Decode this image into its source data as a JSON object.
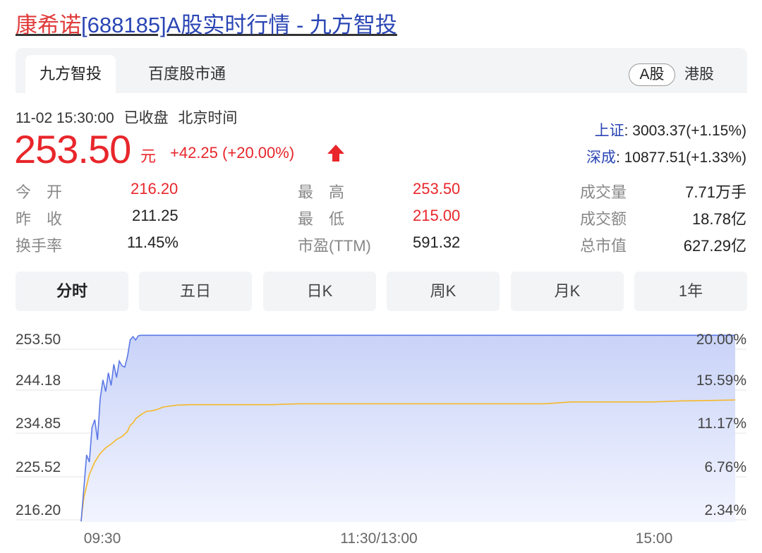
{
  "header": {
    "stock_name": "康希诺",
    "title_rest": "[688185]A股实时行情 - 九方智投"
  },
  "tabs": [
    {
      "label": "九方智投",
      "active": true
    },
    {
      "label": "百度股市通",
      "active": false
    }
  ],
  "market_toggle": {
    "a_share": "A股",
    "hk_share": "港股"
  },
  "quote": {
    "timestamp": "11-02 15:30:00",
    "status": "已收盘",
    "timezone": "北京时间",
    "price": "253.50",
    "unit": "元",
    "change": "+42.25",
    "change_pct": "(+20.00%)",
    "direction_icon": "up-arrow-icon",
    "up_color": "#e8262b"
  },
  "indices": [
    {
      "name": "上证",
      "value": ": 3003.37(+1.15%)"
    },
    {
      "name": "深成",
      "value": ": 10877.51(+1.33%)"
    }
  ],
  "stats": {
    "open_label": "今　开",
    "open": "216.20",
    "prev_close_label": "昨　收",
    "prev_close": "211.25",
    "turnover_rate_label": "换手率",
    "turnover_rate": "11.45%",
    "high_label": "最　高",
    "high": "253.50",
    "low_label": "最　低",
    "low": "215.00",
    "pe_label": "市盈(TTM)",
    "pe": "591.32",
    "volume_label": "成交量",
    "volume": "7.71万手",
    "amount_label": "成交额",
    "amount": "18.78亿",
    "market_cap_label": "总市值",
    "market_cap": "627.29亿"
  },
  "periods": [
    {
      "label": "分时",
      "active": true
    },
    {
      "label": "五日",
      "active": false
    },
    {
      "label": "日K",
      "active": false
    },
    {
      "label": "周K",
      "active": false
    },
    {
      "label": "月K",
      "active": false
    },
    {
      "label": "1年",
      "active": false
    }
  ],
  "chart_data": {
    "type": "area",
    "y_labels": [
      "253.50",
      "244.18",
      "234.85",
      "225.52",
      "216.20"
    ],
    "y_right_labels": [
      "20.00%",
      "15.59%",
      "11.17%",
      "6.76%",
      "2.34%"
    ],
    "x_labels": [
      "09:30",
      "11:30/13:00",
      "15:00"
    ],
    "ylim": [
      213.7,
      254.6
    ],
    "minutes_total": 240,
    "colors": {
      "price_line": "#5b78e6",
      "avg_line": "#f5b82a",
      "area_top": "#c9d3f8",
      "area_bottom": "#f2f4fe",
      "grid": "#e6e6e6"
    },
    "series": [
      {
        "name": "price",
        "x": [
          0,
          2,
          3,
          4,
          5,
          6,
          7,
          8,
          9,
          10,
          11,
          12,
          13,
          14,
          15,
          16,
          17,
          18,
          19,
          20,
          21,
          22,
          240
        ],
        "values": [
          213.8,
          228.0,
          226.5,
          233.8,
          235.5,
          231.2,
          240.0,
          244.0,
          241.5,
          245.5,
          242.8,
          247.3,
          244.5,
          248.0,
          247.0,
          246.7,
          249.0,
          252.5,
          253.2,
          252.5,
          253.4,
          253.5,
          253.5
        ]
      },
      {
        "name": "avg",
        "x": [
          0,
          1,
          3,
          5,
          7,
          9,
          11,
          13,
          15,
          17,
          18,
          19,
          20,
          22,
          24,
          26,
          28,
          30,
          35,
          40,
          50,
          60,
          70,
          80,
          90,
          100,
          110,
          120,
          130,
          150,
          170,
          180,
          190,
          200,
          210,
          220,
          230,
          240
        ],
        "values": [
          214.0,
          219.0,
          223.8,
          226.5,
          228.3,
          229.5,
          230.3,
          231.3,
          231.9,
          233.0,
          234.3,
          234.8,
          235.7,
          236.6,
          237.3,
          237.4,
          237.7,
          238.2,
          238.6,
          238.7,
          238.7,
          238.7,
          238.7,
          238.9,
          238.9,
          238.9,
          238.9,
          238.9,
          238.9,
          238.9,
          238.9,
          239.3,
          239.3,
          239.3,
          239.3,
          239.5,
          239.6,
          239.7
        ]
      }
    ]
  }
}
